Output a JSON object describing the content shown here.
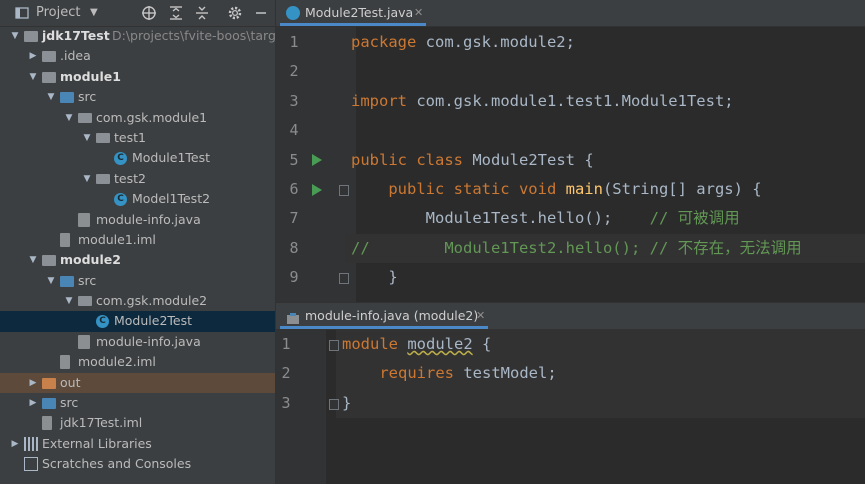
{
  "project_panel": {
    "title": "Project",
    "tree": [
      {
        "label": "jdk17Test",
        "path": "D:\\projects\\fvite-boos\\targ",
        "kind": "module-root",
        "level": 0,
        "expanded": true,
        "bold": true
      },
      {
        "label": ".idea",
        "kind": "folder",
        "level": 1,
        "expanded": false
      },
      {
        "label": "module1",
        "kind": "module-folder",
        "level": 1,
        "expanded": true,
        "bold": true
      },
      {
        "label": "src",
        "kind": "src-folder",
        "level": 2,
        "expanded": true
      },
      {
        "label": "com.gsk.module1",
        "kind": "package",
        "level": 3,
        "expanded": true
      },
      {
        "label": "test1",
        "kind": "package",
        "level": 4,
        "expanded": true
      },
      {
        "label": "Module1Test",
        "kind": "class",
        "level": 5
      },
      {
        "label": "test2",
        "kind": "package",
        "level": 4,
        "expanded": true
      },
      {
        "label": "Model1Test2",
        "kind": "class",
        "level": 5
      },
      {
        "label": "module-info.java",
        "kind": "java-file",
        "level": 3
      },
      {
        "label": "module1.iml",
        "kind": "iml",
        "level": 2
      },
      {
        "label": "module2",
        "kind": "module-folder",
        "level": 1,
        "expanded": true,
        "bold": true
      },
      {
        "label": "src",
        "kind": "src-folder",
        "level": 2,
        "expanded": true
      },
      {
        "label": "com.gsk.module2",
        "kind": "package",
        "level": 3,
        "expanded": true
      },
      {
        "label": "Module2Test",
        "kind": "class",
        "level": 4,
        "selected": true
      },
      {
        "label": "module-info.java",
        "kind": "java-file",
        "level": 3
      },
      {
        "label": "module2.iml",
        "kind": "iml",
        "level": 2
      },
      {
        "label": "out",
        "kind": "excluded-folder",
        "level": 1,
        "expanded": false
      },
      {
        "label": "src",
        "kind": "src-folder",
        "level": 1,
        "expanded": false
      },
      {
        "label": "jdk17Test.iml",
        "kind": "iml",
        "level": 1
      },
      {
        "label": "External Libraries",
        "kind": "libraries",
        "level": 0,
        "expanded": false
      },
      {
        "label": "Scratches and Consoles",
        "kind": "scratches",
        "level": 0
      }
    ]
  },
  "editor_top": {
    "tab": "Module2Test.java",
    "lines": [
      {
        "n": "1",
        "tokens": [
          {
            "t": "package ",
            "c": "kw"
          },
          {
            "t": "com.gsk.module2;",
            "c": "pk"
          }
        ]
      },
      {
        "n": "2",
        "tokens": []
      },
      {
        "n": "3",
        "tokens": [
          {
            "t": "import ",
            "c": "kw"
          },
          {
            "t": "com.gsk.module1.test1.Module1Test;",
            "c": "pk"
          }
        ]
      },
      {
        "n": "4",
        "tokens": []
      },
      {
        "n": "5",
        "tokens": [
          {
            "t": "public class ",
            "c": "kw"
          },
          {
            "t": "Module2Test ",
            "c": "pk"
          },
          {
            "t": "{",
            "c": "pk"
          }
        ]
      },
      {
        "n": "6",
        "tokens": [
          {
            "t": "    public static void ",
            "c": "kw"
          },
          {
            "t": "main",
            "c": "fn"
          },
          {
            "t": "(String[] args) {",
            "c": "pk"
          }
        ]
      },
      {
        "n": "7",
        "tokens": [
          {
            "t": "        Module1Test.",
            "c": "pk"
          },
          {
            "t": "hello",
            "c": "pk"
          },
          {
            "t": "();    ",
            "c": "pk"
          },
          {
            "t": "// 可被调用",
            "c": "cmt"
          }
        ]
      },
      {
        "n": "8",
        "tokens": [
          {
            "t": "//        Module1Test2.hello(); // 不存在，无法调用",
            "c": "cmt"
          }
        ]
      },
      {
        "n": "9",
        "tokens": [
          {
            "t": "    }",
            "c": "pk"
          }
        ]
      }
    ]
  },
  "editor_bottom": {
    "tab": "module-info.java (module2)",
    "lines": [
      {
        "n": "1",
        "tokens": [
          {
            "t": "module ",
            "c": "kw"
          },
          {
            "t": "module2",
            "c": "squig"
          },
          {
            "t": " {",
            "c": "pk"
          }
        ]
      },
      {
        "n": "2",
        "tokens": [
          {
            "t": "    requires ",
            "c": "kw"
          },
          {
            "t": "testModel;",
            "c": "pk"
          }
        ]
      },
      {
        "n": "3",
        "tokens": [
          {
            "t": "}",
            "c": "pk"
          }
        ]
      }
    ]
  },
  "colors": {
    "accent": "#4a88c7",
    "selection": "#0d293e",
    "background": "#2b2b2b",
    "panel": "#3c3f41"
  }
}
